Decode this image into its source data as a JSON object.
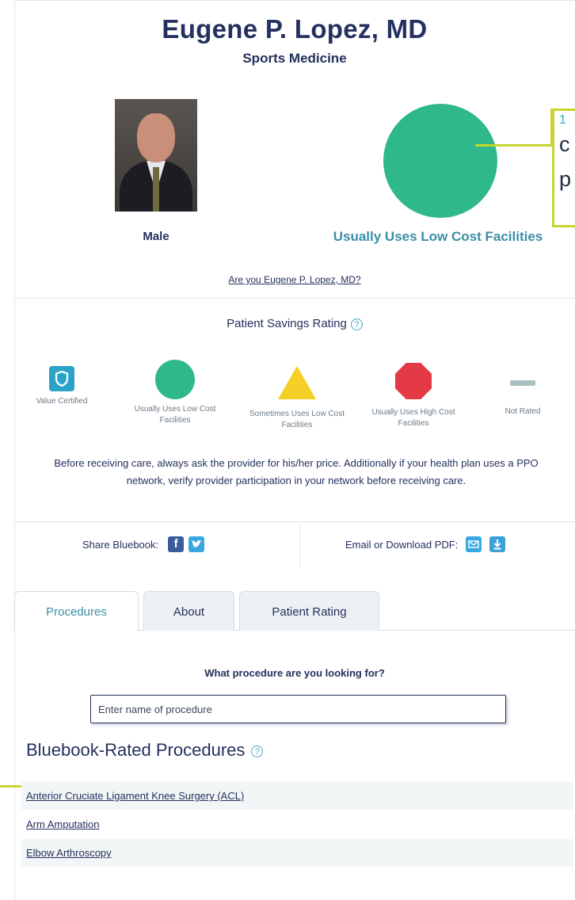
{
  "doctor": {
    "name": "Eugene P. Lopez, MD",
    "specialty": "Sports Medicine",
    "gender": "Male",
    "rating_label": "Usually Uses Low Cost Facilities",
    "claim_link": "Are you Eugene P. Lopez, MD?"
  },
  "callout": {
    "lines": [
      "1",
      "c",
      "p"
    ]
  },
  "savings": {
    "title": "Patient Savings Rating",
    "help": "?",
    "legend": [
      {
        "label": "Value Certified",
        "icon": "shield-icon",
        "color": "#2ba3c8"
      },
      {
        "label": "Usually Uses Low Cost Facilities",
        "icon": "green-circle-icon",
        "color": "#2fb88b"
      },
      {
        "label": "Sometimes Uses Low Cost Facilities",
        "icon": "yellow-triangle-icon",
        "color": "#f4cf25"
      },
      {
        "label": "Usually Uses High Cost Facilities",
        "icon": "red-octagon-icon",
        "color": "#e33a46"
      },
      {
        "label": "Not Rated",
        "icon": "gray-dash-icon",
        "color": "#a8c0bf"
      }
    ],
    "disclaimer": "Before receiving care, always ask the provider for his/her price. Additionally if your health plan uses a PPO network, verify provider participation in your network before receiving care."
  },
  "share": {
    "share_label": "Share Bluebook:",
    "email_label": "Email or Download PDF:"
  },
  "tabs": [
    {
      "label": "Procedures",
      "active": true
    },
    {
      "label": "About",
      "active": false
    },
    {
      "label": "Patient Rating",
      "active": false
    }
  ],
  "procedures": {
    "question": "What procedure are you looking for?",
    "placeholder": "Enter name of procedure",
    "rated_title": "Bluebook-Rated Procedures",
    "items": [
      "Anterior Cruciate Ligament Knee Surgery (ACL)",
      "Arm Amputation",
      "Elbow Arthroscopy"
    ]
  }
}
